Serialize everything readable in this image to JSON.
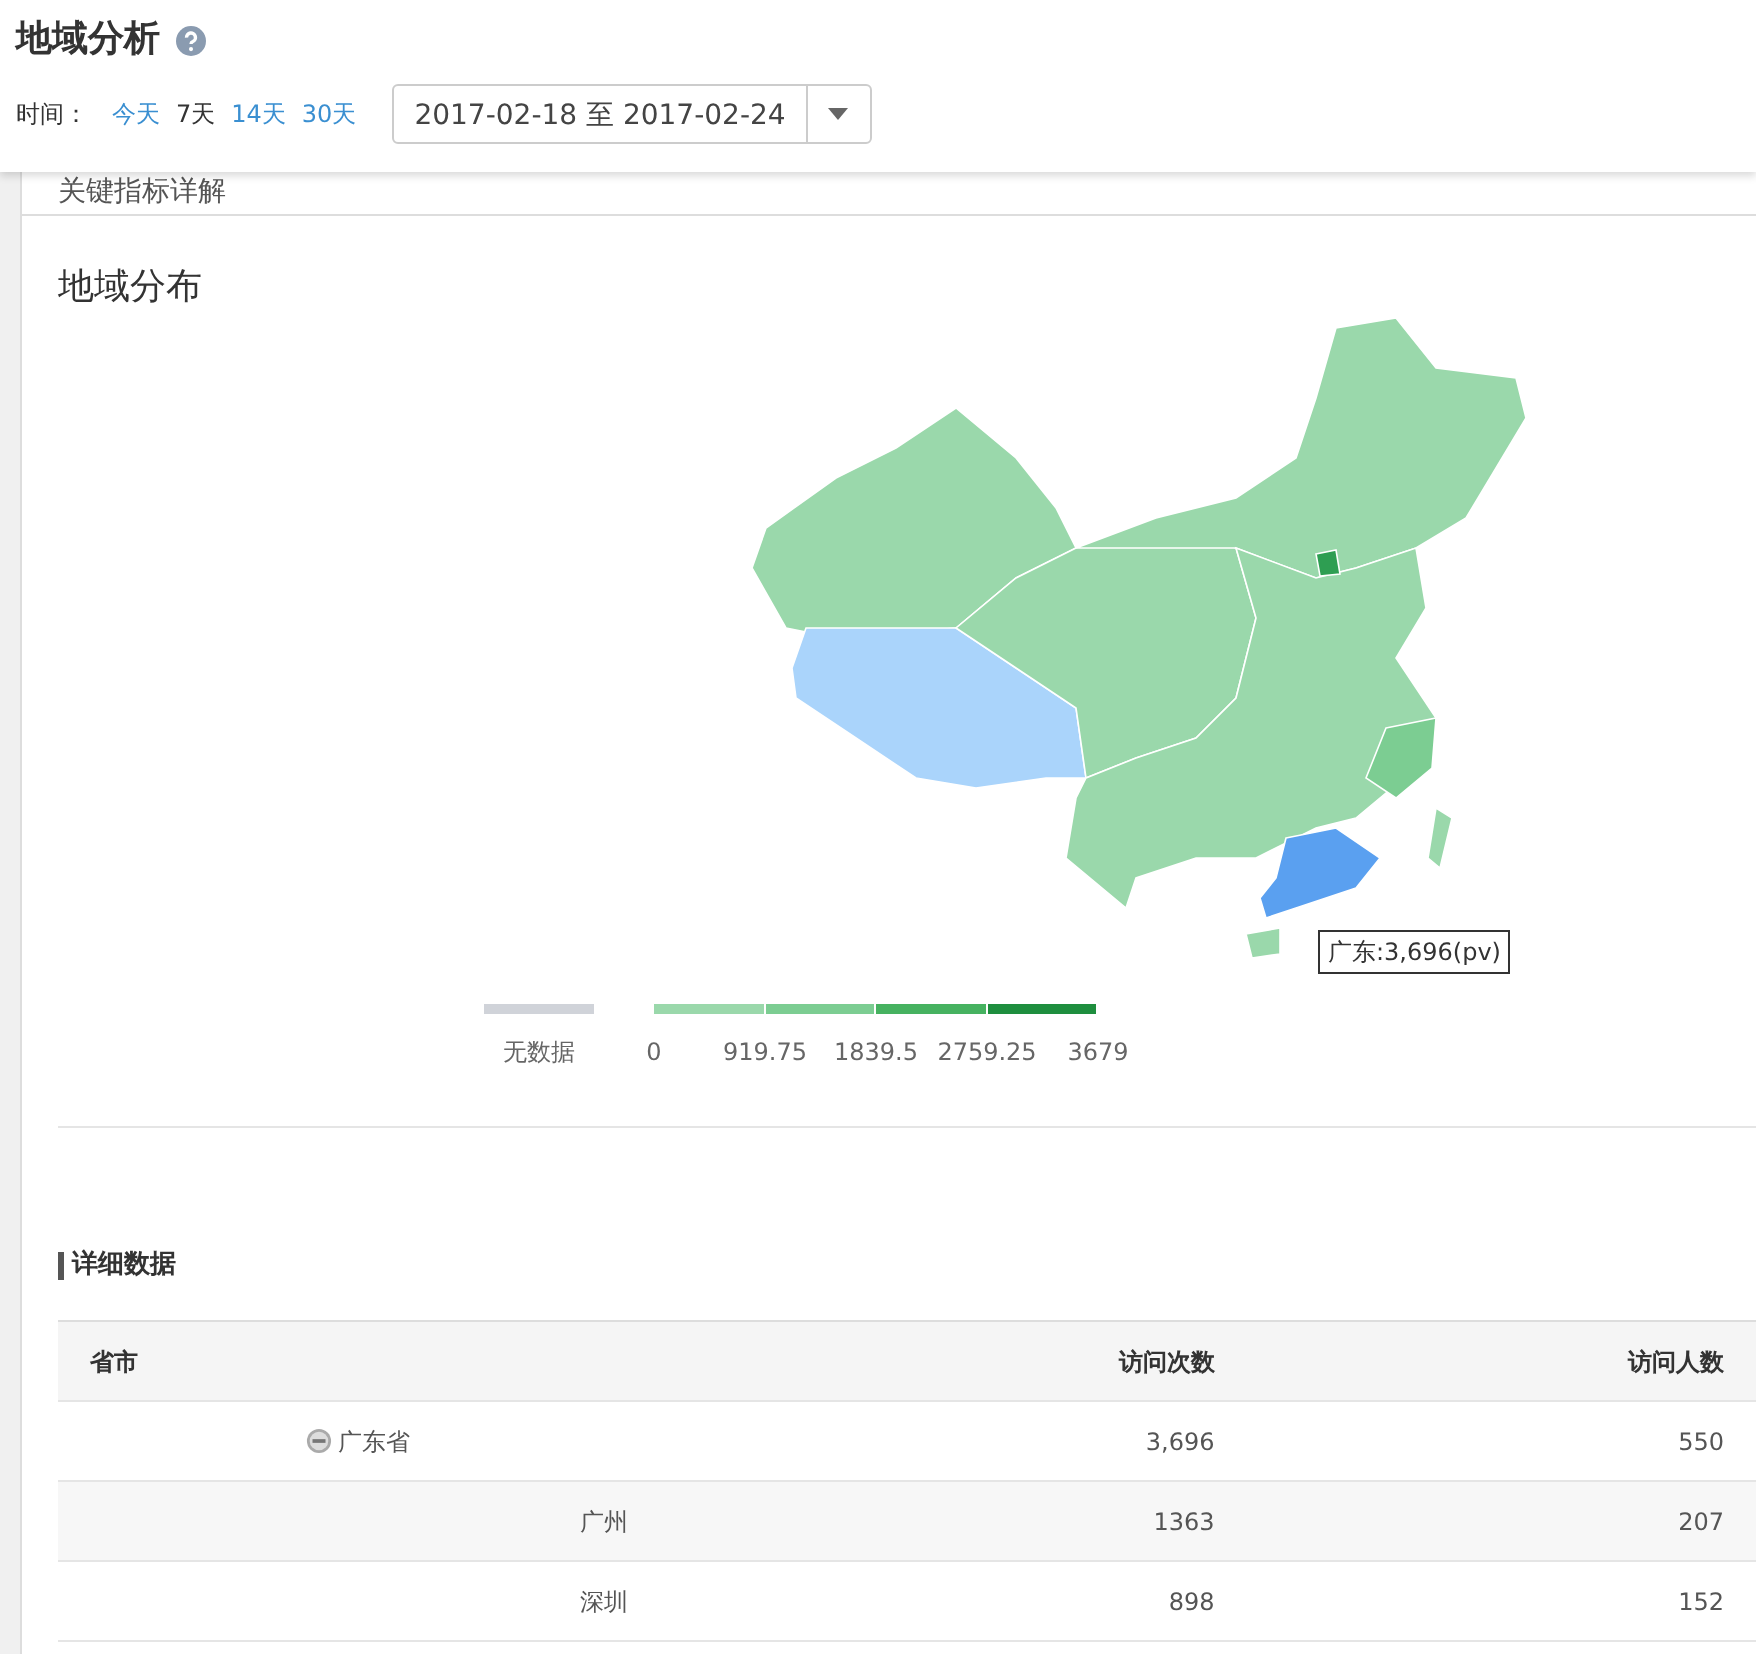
{
  "header": {
    "title": "地域分析",
    "time_label": "时间：",
    "ranges": [
      {
        "label": "今天",
        "selected": false
      },
      {
        "label": "7天",
        "selected": true
      },
      {
        "label": "14天",
        "selected": false
      },
      {
        "label": "30天",
        "selected": false
      }
    ],
    "date_range": "2017-02-18 至 2017-02-24"
  },
  "tab_title": "关键指标详解",
  "map_section": {
    "title": "地域分布",
    "tooltip": "广东:3,696(pv)",
    "legend": {
      "no_data": {
        "label": "无数据",
        "color": "#d0d3d9"
      },
      "segments": [
        {
          "color": "#9ad8ab"
        },
        {
          "color": "#7ccd92"
        },
        {
          "color": "#46b260"
        },
        {
          "color": "#1e8e3e"
        }
      ],
      "ticks": [
        "0",
        "919.75",
        "1839.5",
        "2759.25",
        "3679"
      ]
    }
  },
  "detail": {
    "title": "详细数据",
    "columns": [
      "省市",
      "访问次数",
      "访问人数"
    ],
    "rows": [
      {
        "region": "广东省",
        "visits": "3,696",
        "visitors": "550",
        "expanded": true,
        "children": [
          {
            "region": "广州",
            "visits": "1363",
            "visitors": "207"
          },
          {
            "region": "深圳",
            "visits": "898",
            "visitors": "152"
          }
        ]
      }
    ]
  }
}
